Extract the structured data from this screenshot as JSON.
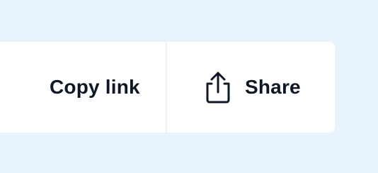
{
  "actions": {
    "copy_link_label": "Copy link",
    "share_label": "Share",
    "share_icon": "share-upload-icon"
  },
  "colors": {
    "background": "#e8f3fe",
    "panel": "#ffffff",
    "text": "#0e1726",
    "divider": "#f0f3f6"
  }
}
